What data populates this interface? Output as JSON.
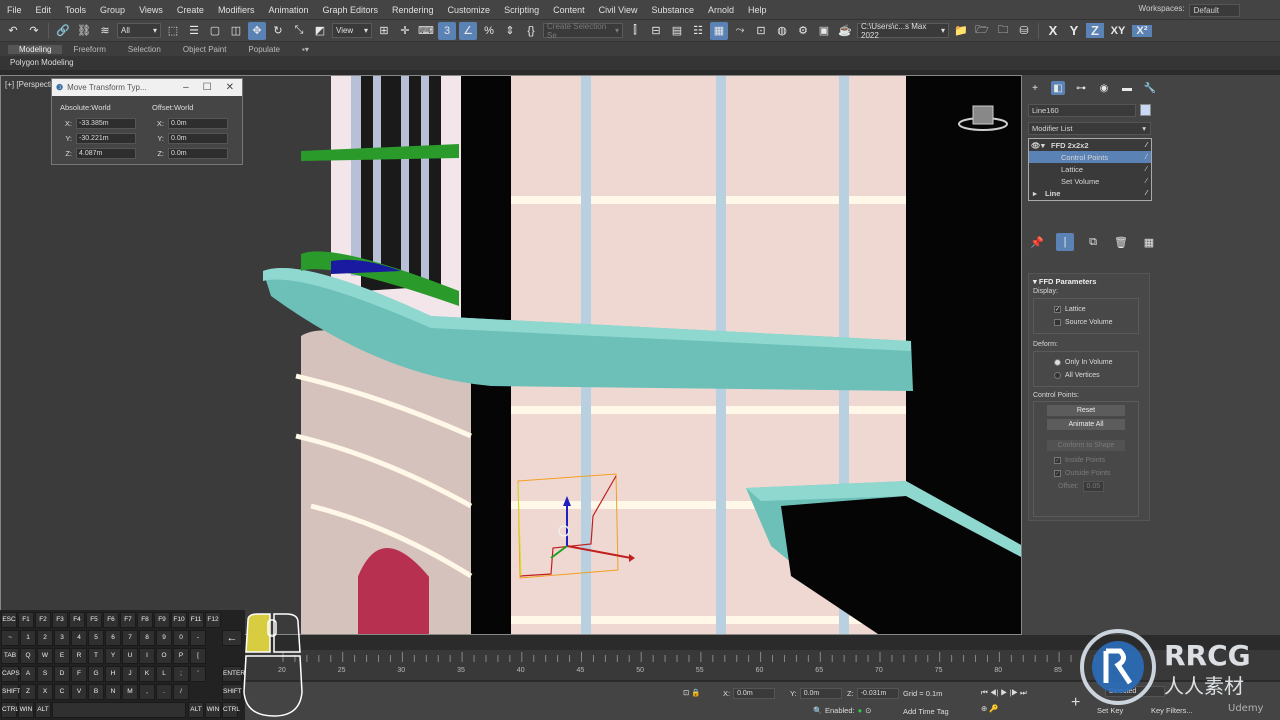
{
  "menu": [
    "File",
    "Edit",
    "Tools",
    "Group",
    "Views",
    "Create",
    "Modifiers",
    "Animation",
    "Graph Editors",
    "Rendering",
    "Customize",
    "Scripting",
    "Content",
    "Civil View",
    "Substance",
    "Arnold",
    "Help"
  ],
  "workspace": {
    "label": "Workspaces:",
    "value": "Default"
  },
  "toolbar": {
    "filter": "All",
    "ref_coord": "View",
    "selection_set_placeholder": "Create Selection Se",
    "project_path": "C:\\Users\\c...s Max 2022",
    "axes": [
      "X",
      "Y",
      "Z",
      "XY",
      "X²"
    ]
  },
  "ribbon": {
    "tabs": [
      "Modeling",
      "Freeform",
      "Selection",
      "Object Paint",
      "Populate"
    ],
    "subtitle": "Polygon Modeling"
  },
  "viewport": {
    "label": "[+] [Perspecti"
  },
  "move_dialog": {
    "title": "Move Transform Typ...",
    "absolute_title": "Absolute:World",
    "offset_title": "Offset:World",
    "absolute": [
      {
        "axis": "X:",
        "value": "-33.385m"
      },
      {
        "axis": "Y:",
        "value": "-30.221m"
      },
      {
        "axis": "Z:",
        "value": "4.087m"
      }
    ],
    "offset": [
      {
        "axis": "X:",
        "value": "0.0m"
      },
      {
        "axis": "Y:",
        "value": "0.0m"
      },
      {
        "axis": "Z:",
        "value": "0.0m"
      }
    ]
  },
  "command_panel": {
    "object_name": "Line160",
    "object_color": "#c8d8f4",
    "modifier_list": "Modifier List",
    "stack": [
      {
        "label": "FFD 2x2x2",
        "level": 0,
        "bold": true
      },
      {
        "label": "Control Points",
        "level": 1,
        "selected": true
      },
      {
        "label": "Lattice",
        "level": 1
      },
      {
        "label": "Set Volume",
        "level": 1
      },
      {
        "label": "Line",
        "level": 0,
        "bold": true
      }
    ],
    "rollout_title": "FFD Parameters",
    "display": {
      "title": "Display:",
      "lattice": "Lattice",
      "source_volume": "Source Volume",
      "lattice_checked": true,
      "source_volume_checked": false
    },
    "deform": {
      "title": "Deform:",
      "only_in_volume": "Only In Volume",
      "all_vertices": "All Vertices",
      "only_in_volume_selected": true
    },
    "control_points": {
      "title": "Control Points:",
      "reset": "Reset",
      "animate_all": "Animate All",
      "conform": "Conform to Shape",
      "inside_points": "Inside Points",
      "outside_points": "Outside Points",
      "offset_label": "Offset:",
      "offset_value": "0.05"
    }
  },
  "timeline": {
    "ticks": [
      "20",
      "25",
      "30",
      "35",
      "40",
      "45",
      "50",
      "55",
      "60",
      "65",
      "70",
      "75",
      "80",
      "85"
    ]
  },
  "status": {
    "x_label": "X:",
    "x_value": "0.0m",
    "y_label": "Y:",
    "y_value": "0.0m",
    "z_label": "Z:",
    "z_value": "-0.031m",
    "grid": "Grid = 0.1m",
    "enabled": "Enabled:",
    "add_time_tag": "Add Time Tag",
    "set_key": "Set Key",
    "key_filters": "Key Filters...",
    "selected": "Selected"
  },
  "keyboard": {
    "row1": [
      "ESC",
      "F1",
      "F2",
      "F3",
      "F4",
      "F5",
      "F6",
      "F7",
      "F8",
      "F9",
      "F10",
      "F11",
      "F12"
    ],
    "row2": [
      "~",
      "1",
      "2",
      "3",
      "4",
      "5",
      "6",
      "7",
      "8",
      "9",
      "0",
      "-",
      "="
    ],
    "row3": [
      "TAB",
      "Q",
      "W",
      "E",
      "R",
      "T",
      "Y",
      "U",
      "I",
      "O",
      "P",
      "[",
      "]",
      "\\"
    ],
    "row4": [
      "CAPS",
      "A",
      "S",
      "D",
      "F",
      "G",
      "H",
      "J",
      "K",
      "L",
      ";",
      "'"
    ],
    "row5": [
      "SHIFT",
      "Z",
      "X",
      "C",
      "V",
      "B",
      "N",
      "M",
      ",",
      ".",
      "/"
    ],
    "row6": [
      "CTRL",
      "WIN",
      "ALT",
      "ALT",
      "WIN",
      "CTRL"
    ],
    "enter": "ENTER",
    "shift_r": "SHIFT"
  },
  "watermark": {
    "brand": "RRCG",
    "cn": "人人素材",
    "udemy": "Udemy"
  }
}
